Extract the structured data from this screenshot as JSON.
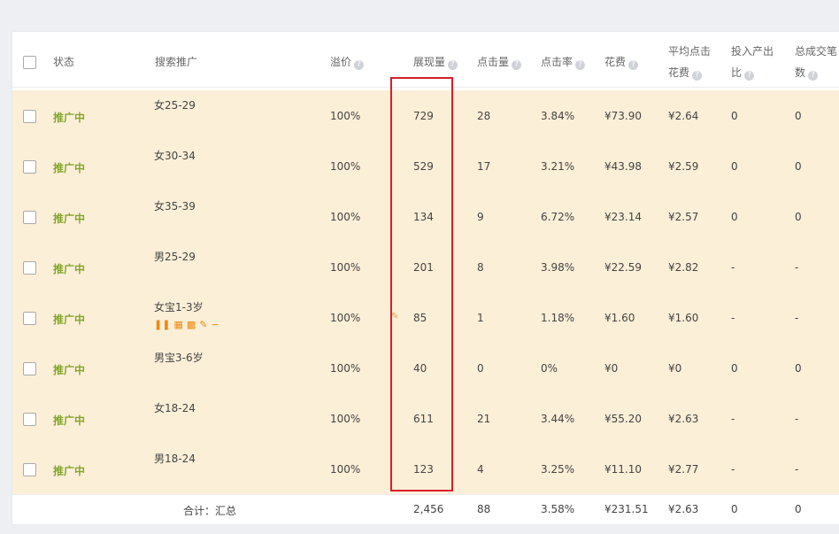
{
  "header": {
    "status": "状态",
    "campaign": "搜索推广",
    "premium": "溢价",
    "impressions": "展现量",
    "clicks": "点击量",
    "ctr": "点击率",
    "spend": "花费",
    "avg_cpc_line1": "平均点击",
    "avg_cpc_line2": "花费",
    "roi_line1": "投入产出",
    "roi_line2": "比",
    "orders_line1": "总成交笔",
    "orders_line2": "数"
  },
  "rows": [
    {
      "status": "推广中",
      "name": "女25-29",
      "premium": "100%",
      "impressions": "729",
      "clicks": "28",
      "ctr": "3.84%",
      "spend": "¥73.90",
      "cpc": "¥2.64",
      "roi": "0",
      "orders": "0"
    },
    {
      "status": "推广中",
      "name": "女30-34",
      "premium": "100%",
      "impressions": "529",
      "clicks": "17",
      "ctr": "3.21%",
      "spend": "¥43.98",
      "cpc": "¥2.59",
      "roi": "0",
      "orders": "0"
    },
    {
      "status": "推广中",
      "name": "女35-39",
      "premium": "100%",
      "impressions": "134",
      "clicks": "9",
      "ctr": "6.72%",
      "spend": "¥23.14",
      "cpc": "¥2.57",
      "roi": "0",
      "orders": "0"
    },
    {
      "status": "推广中",
      "name": "男25-29",
      "premium": "100%",
      "impressions": "201",
      "clicks": "8",
      "ctr": "3.98%",
      "spend": "¥22.59",
      "cpc": "¥2.82",
      "roi": "-",
      "orders": "-"
    },
    {
      "status": "推广中",
      "name": "女宝1-3岁",
      "premium": "100%",
      "impressions": "85",
      "clicks": "1",
      "ctr": "1.18%",
      "spend": "¥1.60",
      "cpc": "¥1.60",
      "roi": "-",
      "orders": "-"
    },
    {
      "status": "推广中",
      "name": "男宝3-6岁",
      "premium": "100%",
      "impressions": "40",
      "clicks": "0",
      "ctr": "0%",
      "spend": "¥0",
      "cpc": "¥0",
      "roi": "0",
      "orders": "0"
    },
    {
      "status": "推广中",
      "name": "女18-24",
      "premium": "100%",
      "impressions": "611",
      "clicks": "21",
      "ctr": "3.44%",
      "spend": "¥55.20",
      "cpc": "¥2.63",
      "roi": "-",
      "orders": "-"
    },
    {
      "status": "推广中",
      "name": "男18-24",
      "premium": "100%",
      "impressions": "123",
      "clicks": "4",
      "ctr": "3.25%",
      "spend": "¥11.10",
      "cpc": "¥2.77",
      "roi": "-",
      "orders": "-"
    }
  ],
  "total": {
    "label": "合计：汇总",
    "impressions": "2,456",
    "clicks": "88",
    "ctr": "3.58%",
    "spend": "¥231.51",
    "cpc": "¥2.63",
    "roi": "0",
    "orders": "0"
  },
  "colors": {
    "row_bg": "#fcefd8",
    "status_green": "#83a62e",
    "highlight_red": "#d81e2c",
    "tool_orange": "#ee8a10"
  }
}
